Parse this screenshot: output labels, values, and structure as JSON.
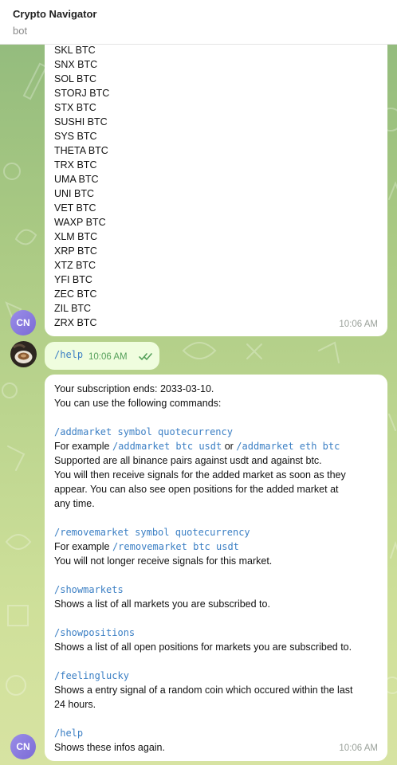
{
  "header": {
    "title": "Crypto Navigator",
    "subtitle": "bot"
  },
  "colors": {
    "accent": "#3b7fc4",
    "bot_avatar": "#8a7be0",
    "outgoing_bubble": "#effdde"
  },
  "list_message": {
    "items": [
      "SKL BTC",
      "SNX BTC",
      "SOL BTC",
      "STORJ BTC",
      "STX BTC",
      "SUSHI BTC",
      "SYS BTC",
      "THETA BTC",
      "TRX BTC",
      "UMA BTC",
      "UNI BTC",
      "VET BTC",
      "WAXP BTC",
      "XLM BTC",
      "XRP BTC",
      "XTZ BTC",
      "YFI BTC",
      "ZEC BTC",
      "ZIL BTC",
      "ZRX BTC"
    ],
    "time": "10:06 AM"
  },
  "bot_avatar": {
    "initials": "CN"
  },
  "user_message": {
    "text": "/help",
    "time": "10:06 AM",
    "status_icon": "double-check-icon"
  },
  "help_message": {
    "intro1": "Your subscription ends: 2033-03-10.",
    "intro2": "You can use the following commands:",
    "add": {
      "cmd": "/addmarket symbol quotecurrency",
      "example_prefix": "For example ",
      "example1": "/addmarket btc usdt",
      "example_or": " or ",
      "example2": "/addmarket eth btc",
      "desc1": "Supported are all binance pairs against usdt and against btc.",
      "desc2": "You will then receive signals for the added market as soon as they",
      "desc3": "appear. You can also see open positions for the added market at",
      "desc4": "any time."
    },
    "remove": {
      "cmd": "/removemarket symbol quotecurrency",
      "example_prefix": "For example ",
      "example": "/removemarket btc usdt",
      "desc": "You will not longer receive signals for this market."
    },
    "showmarkets": {
      "cmd": "/showmarkets",
      "desc": "Shows a list of all markets you are subscribed to."
    },
    "showpositions": {
      "cmd": "/showpositions",
      "desc": "Shows a list of all open positions for markets you are subscribed to."
    },
    "feelinglucky": {
      "cmd": "/feelinglucky",
      "desc1": "Shows a entry signal of a random coin which occured within the last",
      "desc2": "24 hours."
    },
    "help": {
      "cmd": "/help",
      "desc": "Shows these infos again."
    },
    "time": "10:06 AM"
  }
}
